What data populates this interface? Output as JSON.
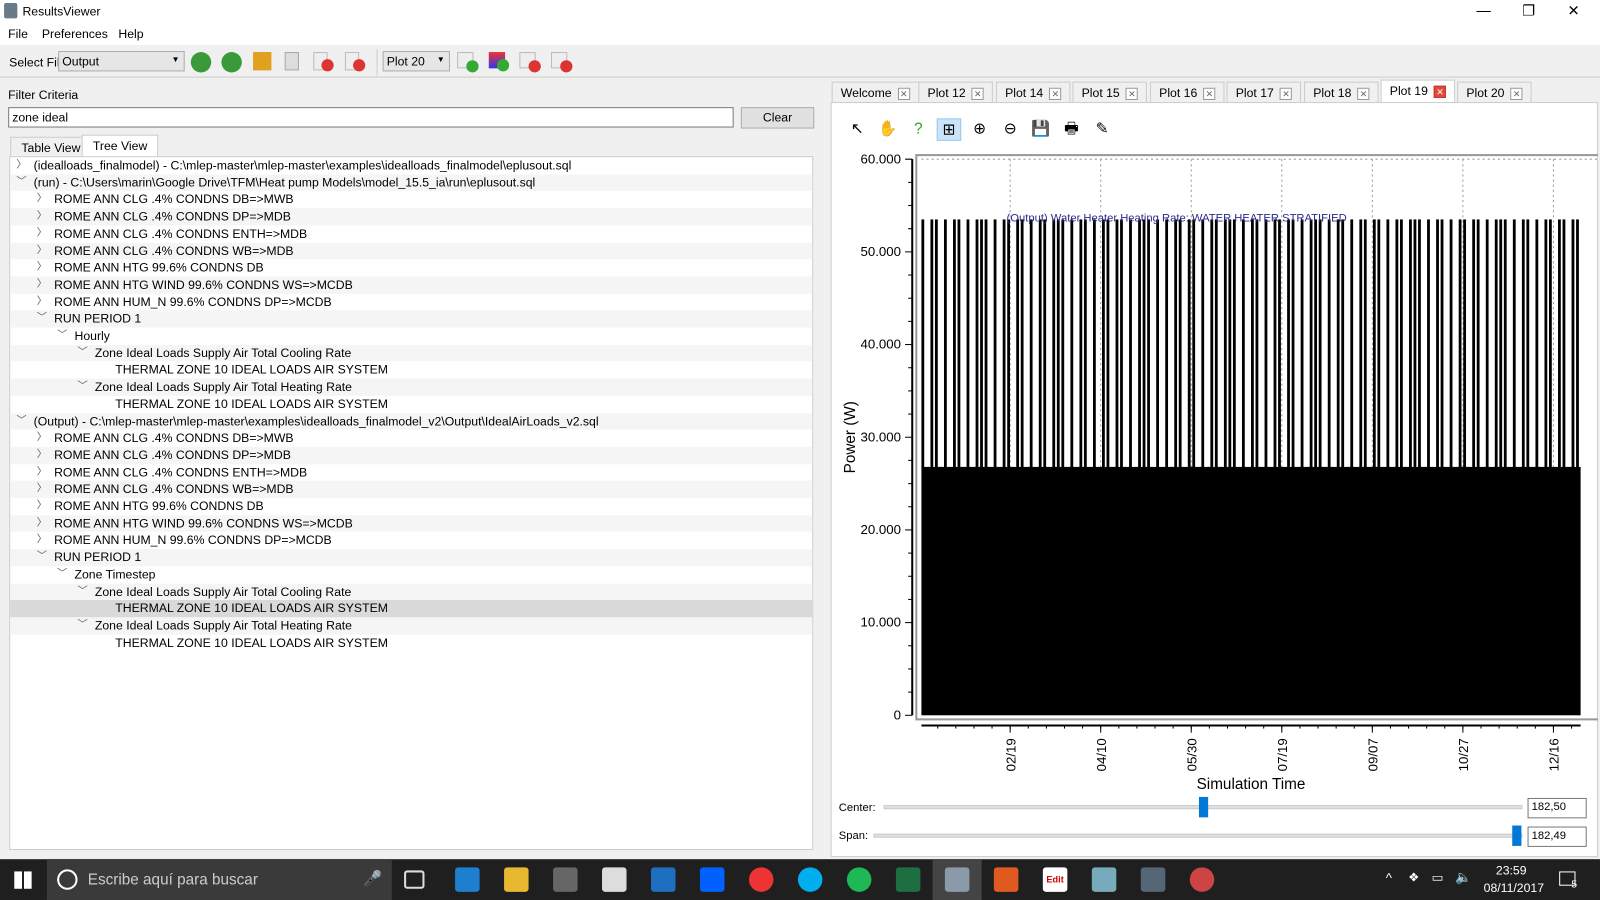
{
  "window": {
    "title": "ResultsViewer",
    "minimize": "—",
    "maximize": "❐",
    "close": "✕"
  },
  "menu": [
    "File",
    "Preferences",
    "Help"
  ],
  "toolbar": {
    "select_file_label": "Select File",
    "file_value": "Output",
    "plot_value": "Plot 20"
  },
  "filter": {
    "label": "Filter Criteria",
    "value": "zone ideal",
    "clear": "Clear"
  },
  "view_tabs": [
    "Table View",
    "Tree View"
  ],
  "active_view_tab": "Tree View",
  "tree": [
    {
      "level": 0,
      "expanded": false,
      "text": "(idealloads_finalmodel) - C:\\mlep-master\\mlep-master\\examples\\idealloads_finalmodel\\eplusout.sql"
    },
    {
      "level": 0,
      "expanded": true,
      "text": "(run) - C:\\Users\\marin\\Google Drive\\TFM\\Heat pump Models\\model_15.5_ia\\run\\eplusout.sql"
    },
    {
      "level": 1,
      "expanded": false,
      "text": "ROME ANN CLG .4% CONDNS DB=>MWB"
    },
    {
      "level": 1,
      "expanded": false,
      "text": "ROME ANN CLG .4% CONDNS DP=>MDB"
    },
    {
      "level": 1,
      "expanded": false,
      "text": "ROME ANN CLG .4% CONDNS ENTH=>MDB"
    },
    {
      "level": 1,
      "expanded": false,
      "text": "ROME ANN CLG .4% CONDNS WB=>MDB"
    },
    {
      "level": 1,
      "expanded": false,
      "text": "ROME ANN HTG 99.6% CONDNS DB"
    },
    {
      "level": 1,
      "expanded": false,
      "text": "ROME ANN HTG WIND 99.6% CONDNS WS=>MCDB"
    },
    {
      "level": 1,
      "expanded": false,
      "text": "ROME ANN HUM_N 99.6% CONDNS DP=>MCDB"
    },
    {
      "level": 1,
      "expanded": true,
      "text": "RUN PERIOD 1"
    },
    {
      "level": 2,
      "expanded": true,
      "text": "Hourly"
    },
    {
      "level": 3,
      "expanded": true,
      "text": "Zone Ideal Loads Supply Air Total Cooling Rate"
    },
    {
      "level": 4,
      "text": "THERMAL ZONE 10 IDEAL LOADS AIR SYSTEM"
    },
    {
      "level": 3,
      "expanded": true,
      "text": "Zone Ideal Loads Supply Air Total Heating Rate"
    },
    {
      "level": 4,
      "text": "THERMAL ZONE 10 IDEAL LOADS AIR SYSTEM"
    },
    {
      "level": 0,
      "expanded": true,
      "text": "(Output) - C:\\mlep-master\\mlep-master\\examples\\idealloads_finalmodel_v2\\Output\\IdealAirLoads_v2.sql"
    },
    {
      "level": 1,
      "expanded": false,
      "text": "ROME ANN CLG .4% CONDNS DB=>MWB"
    },
    {
      "level": 1,
      "expanded": false,
      "text": "ROME ANN CLG .4% CONDNS DP=>MDB"
    },
    {
      "level": 1,
      "expanded": false,
      "text": "ROME ANN CLG .4% CONDNS ENTH=>MDB"
    },
    {
      "level": 1,
      "expanded": false,
      "text": "ROME ANN CLG .4% CONDNS WB=>MDB"
    },
    {
      "level": 1,
      "expanded": false,
      "text": "ROME ANN HTG 99.6% CONDNS DB"
    },
    {
      "level": 1,
      "expanded": false,
      "text": "ROME ANN HTG WIND 99.6% CONDNS WS=>MCDB"
    },
    {
      "level": 1,
      "expanded": false,
      "text": "ROME ANN HUM_N 99.6% CONDNS DP=>MCDB"
    },
    {
      "level": 1,
      "expanded": true,
      "text": "RUN PERIOD 1"
    },
    {
      "level": 2,
      "expanded": true,
      "text": "Zone Timestep"
    },
    {
      "level": 3,
      "expanded": true,
      "text": "Zone Ideal Loads Supply Air Total Cooling Rate"
    },
    {
      "level": 4,
      "text": "THERMAL ZONE 10 IDEAL LOADS AIR SYSTEM",
      "selected": true
    },
    {
      "level": 3,
      "expanded": true,
      "text": "Zone Ideal Loads Supply Air Total Heating Rate"
    },
    {
      "level": 4,
      "text": "THERMAL ZONE 10 IDEAL LOADS AIR SYSTEM"
    }
  ],
  "plot_tabs": [
    "Welcome",
    "Plot 12",
    "Plot 14",
    "Plot 15",
    "Plot 16",
    "Plot 17",
    "Plot 18",
    "Plot 19",
    "Plot 20"
  ],
  "active_plot_tab": "Plot 19",
  "plot_tools": [
    "select-pointer",
    "pan-hand",
    "whats-this-help",
    "zoom-box",
    "zoom-in",
    "zoom-out",
    "save",
    "print",
    "edit-plot"
  ],
  "chart_data": {
    "type": "area",
    "series": [
      {
        "name": "(Output) Water Heater Heating Rate: WATER HEATER STRATIFIED",
        "color": "#000000",
        "baseline": 26.8,
        "values": [
          53.5,
          26.8,
          53.5,
          53.5,
          26.8,
          53.5,
          26.8,
          53.5,
          53.5,
          26.8,
          53.5,
          26.8,
          53.5,
          53.5,
          53.5,
          26.8,
          53.5,
          26.8,
          53.5,
          53.5,
          26.8,
          53.5,
          53.5,
          26.8,
          53.5,
          26.8,
          53.5,
          53.5,
          26.8,
          53.5,
          53.5,
          53.5,
          26.8,
          53.5,
          26.8,
          53.5,
          53.5,
          26.8,
          53.5,
          26.8,
          53.5,
          53.5,
          26.8,
          53.5,
          53.5,
          26.8,
          53.5,
          26.8,
          53.5,
          53.5,
          53.5,
          26.8,
          53.5,
          26.8,
          53.5,
          26.8,
          53.5,
          53.5,
          26.8,
          53.5,
          53.5,
          26.8,
          53.5,
          26.8,
          53.5,
          53.5,
          26.8,
          53.5,
          53.5,
          53.5,
          26.8,
          53.5,
          26.8,
          53.5,
          53.5,
          26.8,
          53.5,
          26.8,
          53.5,
          53.5,
          26.8,
          53.5,
          53.5,
          26.8,
          53.5,
          26.8,
          53.5,
          53.5,
          53.5,
          26.8,
          53.5,
          26.8,
          53.5,
          53.5,
          26.8,
          53.5,
          26.8,
          53.5,
          53.5,
          26.8,
          53.5,
          53.5,
          26.8,
          53.5,
          26.8,
          53.5,
          53.5,
          26.8,
          53.5,
          53.5,
          53.5,
          26.8,
          53.5,
          26.8,
          53.5,
          53.5,
          26.8,
          53.5,
          26.8,
          53.5,
          53.5,
          26.8,
          53.5,
          53.5,
          26.8,
          53.5,
          26.8,
          53.5,
          53.5,
          53.5,
          26.8,
          53.5,
          26.8,
          53.5,
          53.5,
          26.8,
          53.5,
          26.8,
          53.5,
          53.5,
          26.8,
          53.5,
          53.5,
          26.8,
          53.5,
          53.5
        ]
      }
    ],
    "xlabel": "Simulation Time",
    "ylabel": "Power (W)",
    "xrange_days": [
      1,
      365
    ],
    "xticks": [
      {
        "day": 50,
        "label": "02/19"
      },
      {
        "day": 100,
        "label": "04/10"
      },
      {
        "day": 150,
        "label": "05/30"
      },
      {
        "day": 200,
        "label": "07/19"
      },
      {
        "day": 250,
        "label": "09/07"
      },
      {
        "day": 300,
        "label": "10/27"
      },
      {
        "day": 350,
        "label": "12/16"
      }
    ],
    "ylim": [
      0,
      60
    ],
    "yticks": [
      {
        "v": 0,
        "label": "0"
      },
      {
        "v": 10,
        "label": "10.000"
      },
      {
        "v": 20,
        "label": "20.000"
      },
      {
        "v": 30,
        "label": "30.000"
      },
      {
        "v": 40,
        "label": "40.000"
      },
      {
        "v": 50,
        "label": "50.000"
      },
      {
        "v": 60,
        "label": "60.000"
      }
    ],
    "grid": true,
    "legend": "top-center"
  },
  "controls": {
    "center_label": "Center:",
    "center_value": "182,50",
    "center_fraction": 0.5,
    "span_label": "Span:",
    "span_value": "182,49",
    "span_fraction": 1.0
  },
  "taskbar": {
    "search_placeholder": "Escribe aquí para buscar",
    "time": "23:59",
    "date": "08/11/2017",
    "notifications": "5"
  }
}
